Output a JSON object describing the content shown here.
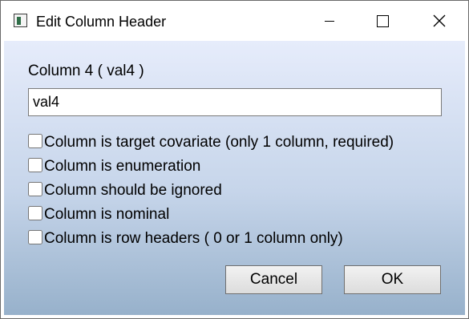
{
  "window": {
    "title": "Edit Column Header",
    "controls": {
      "minimize": "minimize-icon",
      "maximize": "maximize-icon",
      "close": "close-icon"
    }
  },
  "dialog": {
    "column_label": "Column 4 ( val4 )",
    "name_value": "val4",
    "options": [
      {
        "label": "Column is target covariate (only 1 column, required)",
        "checked": false
      },
      {
        "label": "Column is enumeration",
        "checked": false
      },
      {
        "label": "Column should be ignored",
        "checked": false
      },
      {
        "label": "Column is nominal",
        "checked": false
      },
      {
        "label": "Column is row headers ( 0 or 1 column only)",
        "checked": false
      }
    ],
    "cancel_label": "Cancel",
    "ok_label": "OK"
  },
  "colors": {
    "gradient_top": "#e6ecfb",
    "gradient_bottom": "#97b1cb",
    "app_icon_accent": "#2f6e48"
  }
}
